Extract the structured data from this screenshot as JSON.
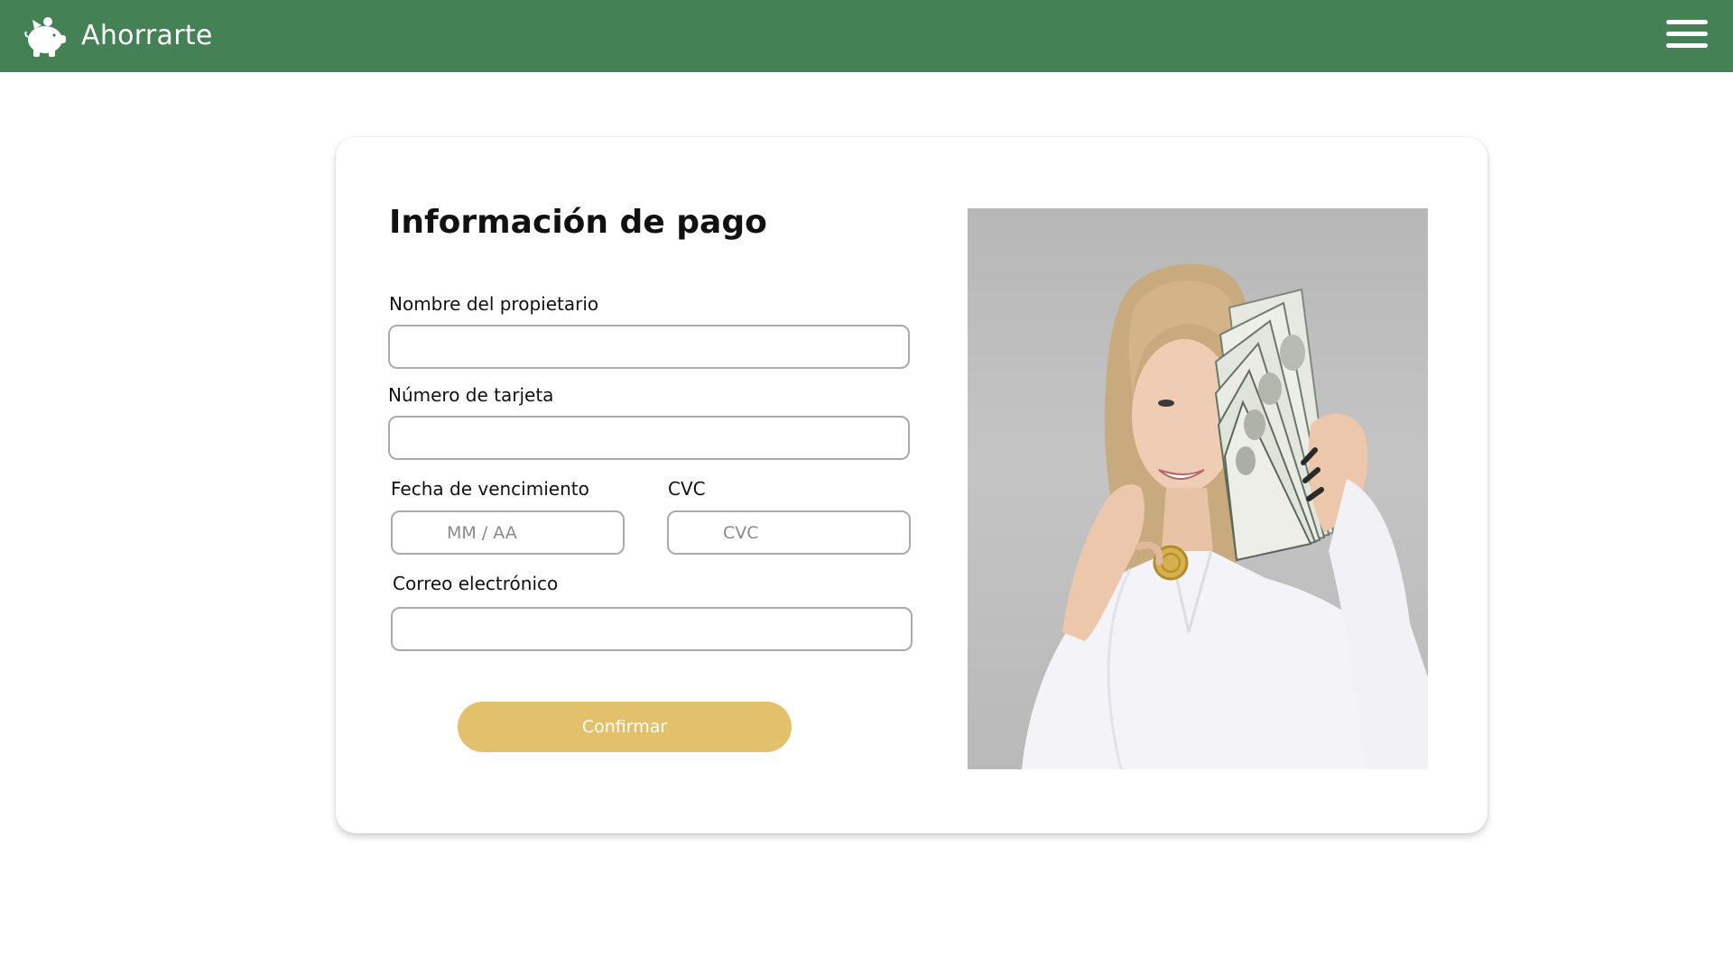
{
  "header": {
    "brand_name": "Ahorrarte",
    "logo_icon": "piggy-bank-icon",
    "menu_icon": "hamburger-menu-icon",
    "background_color": "#448155"
  },
  "form": {
    "title": "Información de pago",
    "fields": {
      "owner_name": {
        "label": "Nombre del propietario",
        "value": "",
        "placeholder": ""
      },
      "card_number": {
        "label": "Número de tarjeta",
        "value": "",
        "placeholder": ""
      },
      "expiry": {
        "label": "Fecha de vencimiento",
        "value": "",
        "placeholder": "MM / AA"
      },
      "cvc": {
        "label": "CVC",
        "value": "",
        "placeholder": "CVC"
      },
      "email": {
        "label": "Correo electrónico",
        "value": "",
        "placeholder": ""
      }
    },
    "confirm_label": "Confirmar",
    "confirm_color": "#e3c06b"
  },
  "photo": {
    "subject": "woman-holding-dollar-bills-and-gold-coin"
  }
}
